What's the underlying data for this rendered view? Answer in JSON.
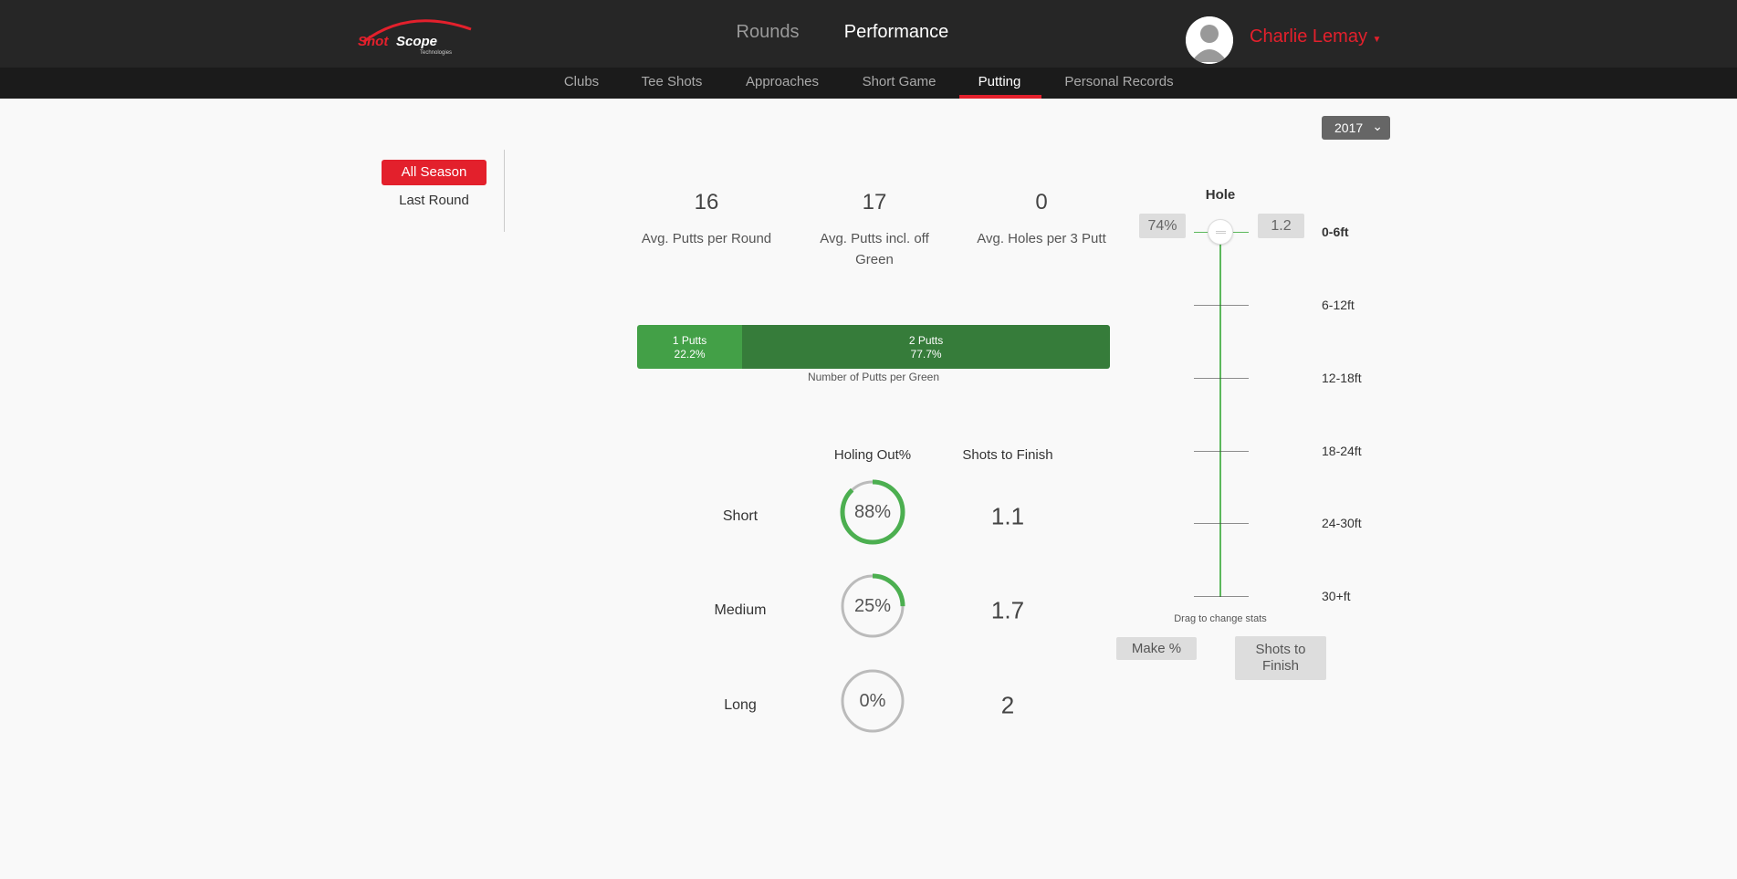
{
  "brand": {
    "logo_text": "Shot Scope",
    "logo_sub": "Technologies",
    "accent": "#e3202c"
  },
  "nav": {
    "rounds": "Rounds",
    "performance": "Performance"
  },
  "user": {
    "name": "Charlie Lemay",
    "icon": "avatar-placeholder"
  },
  "subnav": [
    "Clubs",
    "Tee Shots",
    "Approaches",
    "Short Game",
    "Putting",
    "Personal Records"
  ],
  "active_subnav": "Putting",
  "year": {
    "selected": "2017"
  },
  "sidebar": {
    "all_season": "All Season",
    "last_round": "Last Round"
  },
  "stats": [
    {
      "value": "16",
      "label": "Avg. Putts per Round"
    },
    {
      "value": "17",
      "label": "Avg. Putts incl. off Green"
    },
    {
      "value": "0",
      "label": "Avg. Holes per 3 Putt"
    }
  ],
  "putts_bar": {
    "caption": "Number of Putts per Green",
    "segments": [
      {
        "label": "1 Putts",
        "pct": "22.2%",
        "value": 22.2,
        "color": "#43a047"
      },
      {
        "label": "2 Putts",
        "pct": "77.7%",
        "value": 77.7,
        "color": "#367c3a"
      }
    ]
  },
  "table": {
    "headers": [
      "Holing Out%",
      "Shots to Finish"
    ],
    "rows": [
      {
        "label": "Short",
        "holing": "88%",
        "holing_value": 88,
        "shots": "1.1"
      },
      {
        "label": "Medium",
        "holing": "25%",
        "holing_value": 25,
        "shots": "1.7"
      },
      {
        "label": "Long",
        "holing": "0%",
        "holing_value": 0,
        "shots": "2"
      }
    ]
  },
  "slider": {
    "title": "Hole",
    "make_pct": "74%",
    "shots": "1.2",
    "selected": "0-6ft",
    "distances": [
      "0-6ft",
      "6-12ft",
      "12-18ft",
      "18-24ft",
      "24-30ft",
      "30+ft"
    ],
    "hint": "Drag to change stats",
    "make_button": "Make %",
    "shots_button": "Shots to Finish"
  }
}
